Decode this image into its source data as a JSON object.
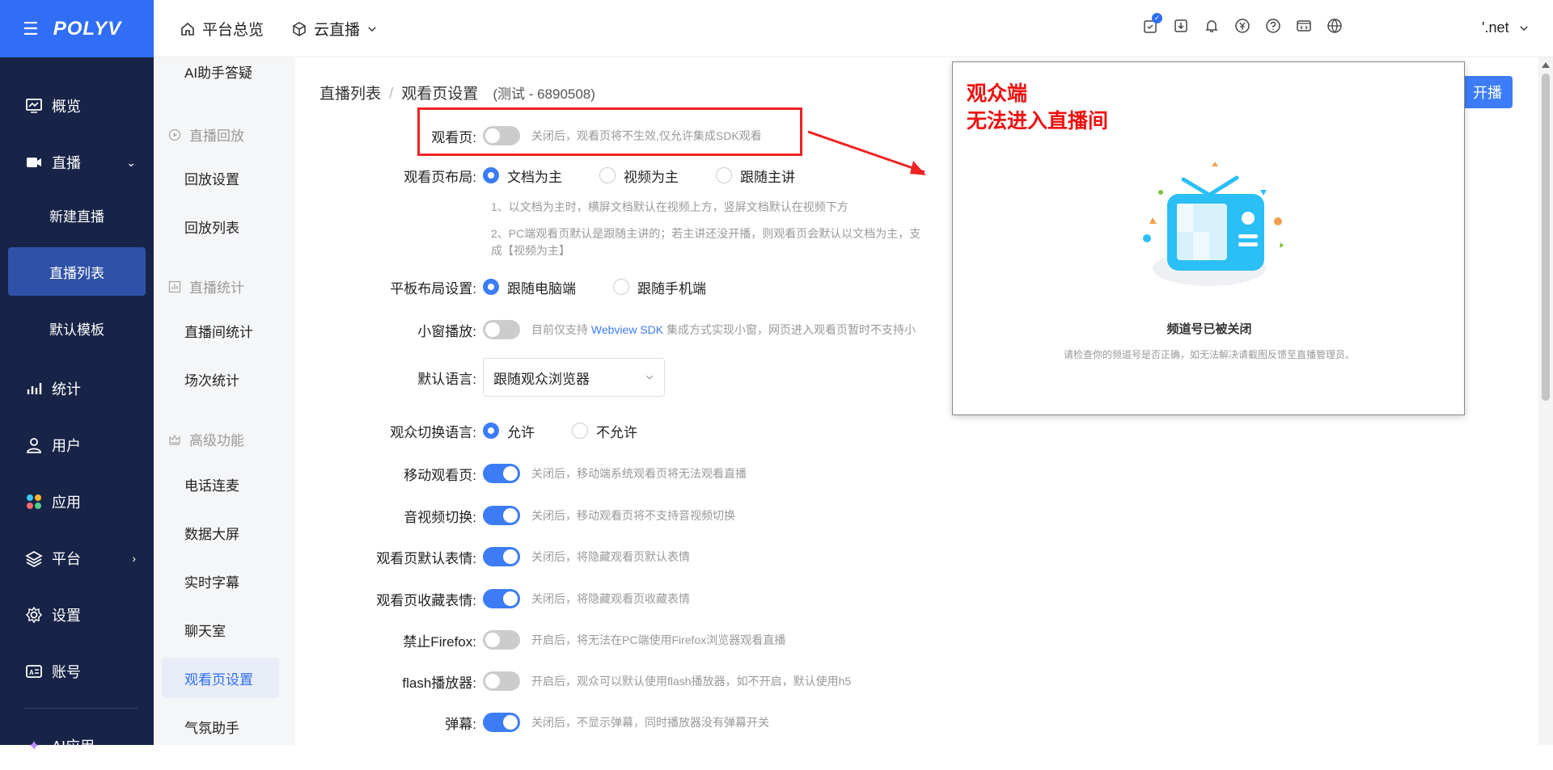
{
  "brand": {
    "logo": "POLYV"
  },
  "topnav": {
    "overview": "平台总览",
    "live": "云直播"
  },
  "topbar": {
    "user": "'.net"
  },
  "sidebar": {
    "items": [
      {
        "label": "概览",
        "icon": "monitor-icon"
      },
      {
        "label": "直播",
        "icon": "video-icon"
      },
      {
        "label": "统计",
        "icon": "chart-icon"
      },
      {
        "label": "用户",
        "icon": "user-icon"
      },
      {
        "label": "应用",
        "icon": "apps-icon"
      },
      {
        "label": "平台",
        "icon": "layers-icon"
      },
      {
        "label": "设置",
        "icon": "gear-icon"
      },
      {
        "label": "账号",
        "icon": "id-card-icon"
      }
    ],
    "live_sub": [
      "新建直播",
      "直播列表",
      "默认模板"
    ],
    "bottom": "AI应用"
  },
  "subnav": {
    "top_item": "AI助手答疑",
    "groups": {
      "replay": "直播回放",
      "stats": "直播统计",
      "advanced": "高级功能"
    },
    "replay_items": [
      "回放设置",
      "回放列表"
    ],
    "stats_items": [
      "直播间统计",
      "场次统计"
    ],
    "advanced_items": [
      "电话连麦",
      "数据大屏",
      "实时字幕",
      "聊天室",
      "观看页设置",
      "气氛助手"
    ]
  },
  "breadcrumb": {
    "root": "直播列表",
    "sep": "/",
    "current": "观看页设置",
    "channel": "(测试 - 6890508)"
  },
  "start_button": "开播",
  "settings": {
    "watch_page": {
      "label": "观看页:",
      "hint": "关闭后，观看页将不生效,仅允许集成SDK观看",
      "on": false
    },
    "layout": {
      "label": "观看页布局:",
      "options": [
        "文档为主",
        "视频为主",
        "跟随主讲"
      ],
      "selected": 0,
      "note1": "1、以文档为主时，横屏文档默认在视频上方，竖屏文档默认在视频下方",
      "note2": "2、PC端观看页默认是跟随主讲的；若主讲还没开播，则观看页会默认以文档为主，支",
      "note3": "成【视频为主】"
    },
    "tablet": {
      "label": "平板布局设置:",
      "options": [
        "跟随电脑端",
        "跟随手机端"
      ],
      "selected": 0
    },
    "mini": {
      "label": "小窗播放:",
      "hint_a": "目前仅支持 ",
      "hint_link": "Webview SDK",
      "hint_b": " 集成方式实现小窗，网页进入观看页暂时不支持小",
      "on": false
    },
    "language": {
      "label": "默认语言:",
      "value": "跟随观众浏览器"
    },
    "switch_lang": {
      "label": "观众切换语言:",
      "options": [
        "允许",
        "不允许"
      ],
      "selected": 0
    },
    "mobile": {
      "label": "移动观看页:",
      "hint": "关闭后，移动端系统观看页将无法观看直播",
      "on": true
    },
    "av_switch": {
      "label": "音视频切换:",
      "hint": "关闭后，移动观看页将不支持音视频切换",
      "on": true
    },
    "emoji_default": {
      "label": "观看页默认表情:",
      "hint": "关闭后，将隐藏观看页默认表情",
      "on": true
    },
    "emoji_fav": {
      "label": "观看页收藏表情:",
      "hint": "关闭后，将隐藏观看页收藏表情",
      "on": true
    },
    "firefox": {
      "label": "禁止Firefox:",
      "hint": "开启后，将无法在PC端使用Firefox浏览器观看直播",
      "on": false
    },
    "flash": {
      "label": "flash播放器:",
      "hint": "开启后，观众可以默认使用flash播放器，如不开启，默认使用h5",
      "on": false
    },
    "danmaku": {
      "label": "弹幕:",
      "hint": "关闭后，不显示弹幕，同时播放器没有弹幕开关",
      "on": true
    }
  },
  "popup": {
    "heading1": "观众端",
    "heading2": "无法进入直播间",
    "title": "频道号已被关闭",
    "desc": "请检查你的频道号是否正确，如无法解决请截图反馈至直播管理员。"
  },
  "colors": {
    "primary": "#3c7cf6",
    "sidebar": "#182447",
    "alert": "#ee2222"
  }
}
